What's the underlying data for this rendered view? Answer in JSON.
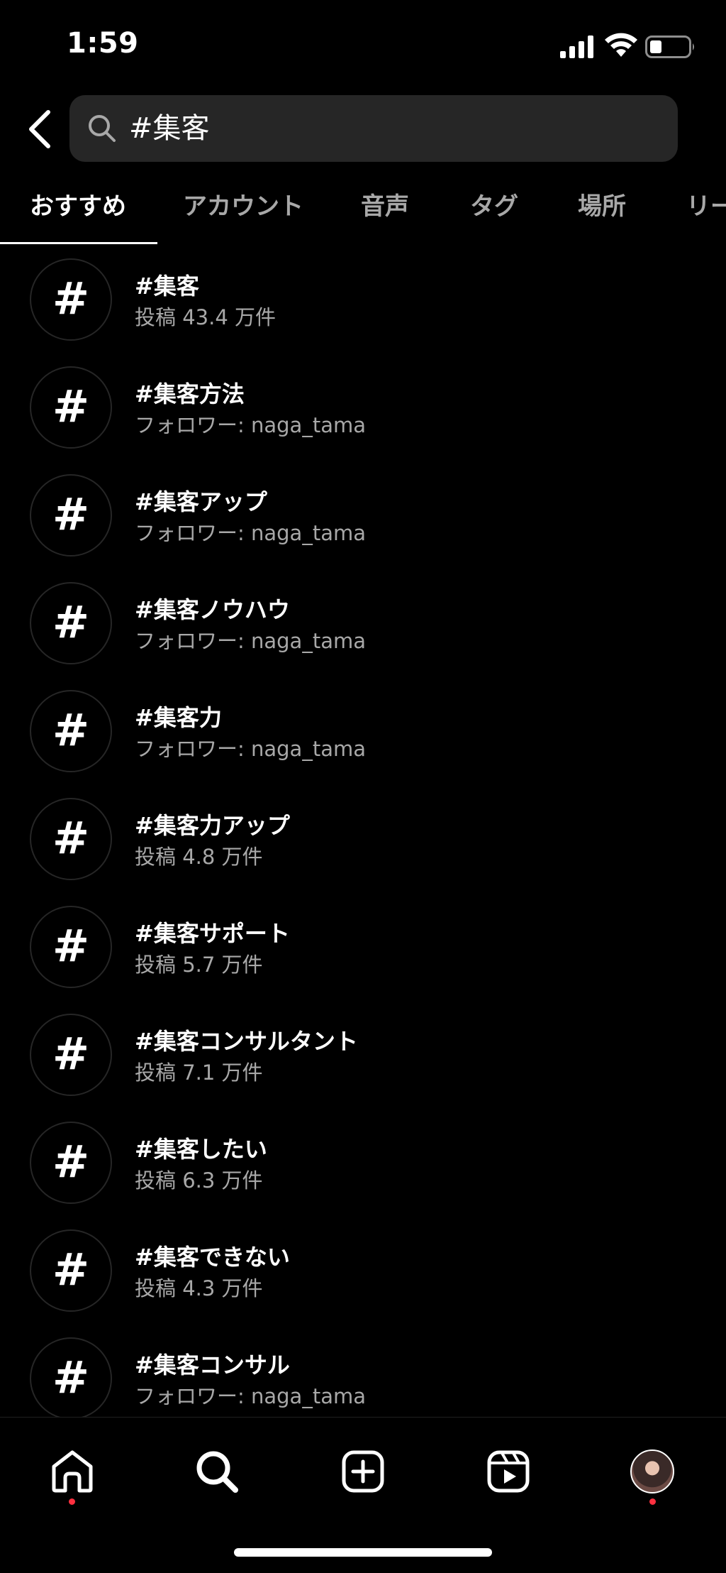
{
  "status_bar": {
    "time": "1:59"
  },
  "search": {
    "query": "#集客"
  },
  "tabs": [
    {
      "label": "おすすめ",
      "active": true
    },
    {
      "label": "アカウント",
      "active": false
    },
    {
      "label": "音声",
      "active": false
    },
    {
      "label": "タグ",
      "active": false
    },
    {
      "label": "場所",
      "active": false
    },
    {
      "label": "リー",
      "active": false
    }
  ],
  "results": [
    {
      "title": "#集客",
      "subtitle": "投稿 43.4 万件"
    },
    {
      "title": "#集客方法",
      "subtitle": "フォロワー: naga_tama"
    },
    {
      "title": "#集客アップ",
      "subtitle": "フォロワー: naga_tama"
    },
    {
      "title": "#集客ノウハウ",
      "subtitle": "フォロワー: naga_tama"
    },
    {
      "title": "#集客力",
      "subtitle": "フォロワー: naga_tama"
    },
    {
      "title": "#集客力アップ",
      "subtitle": "投稿 4.8 万件"
    },
    {
      "title": "#集客サポート",
      "subtitle": "投稿 5.7 万件"
    },
    {
      "title": "#集客コンサルタント",
      "subtitle": "投稿 7.1 万件"
    },
    {
      "title": "#集客したい",
      "subtitle": "投稿 6.3 万件"
    },
    {
      "title": "#集客できない",
      "subtitle": "投稿 4.3 万件"
    },
    {
      "title": "#集客コンサル",
      "subtitle": "フォロワー: naga_tama"
    }
  ],
  "hash_symbol": "#",
  "bottom_nav": [
    {
      "icon": "home-icon",
      "has_notification": true
    },
    {
      "icon": "search-icon",
      "has_notification": false
    },
    {
      "icon": "create-post-icon",
      "has_notification": false
    },
    {
      "icon": "reels-icon",
      "has_notification": false
    },
    {
      "icon": "profile-avatar",
      "has_notification": true
    }
  ],
  "colors": {
    "background": "#000000",
    "search_field": "#262626",
    "secondary_text": "#a8a8a8",
    "notification": "#ff3040"
  }
}
